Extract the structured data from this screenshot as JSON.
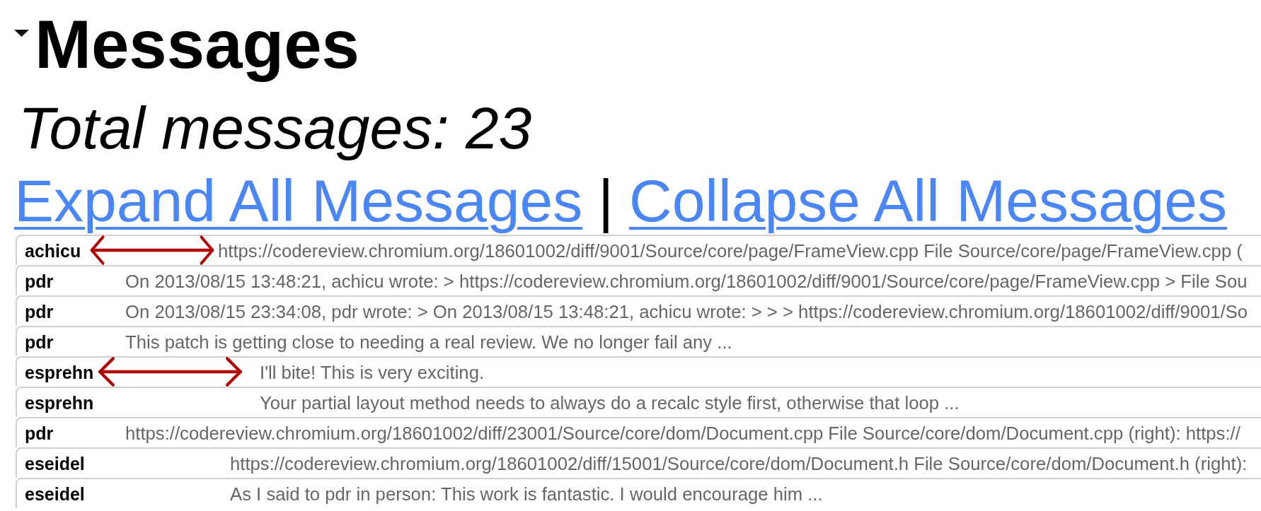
{
  "section": {
    "title": "Messages",
    "expanded": true
  },
  "total": "Total messages: 23",
  "actions": {
    "expand": "Expand All Messages",
    "separator": "|",
    "collapse": "Collapse All Messages"
  },
  "messages": [
    {
      "author": "achicu",
      "text": "https://codereview.chromium.org/18601002/diff/9001/Source/core/page/FrameView.cpp File Source/core/page/FrameView.cpp (",
      "annotated": true
    },
    {
      "author": "pdr",
      "text": "On 2013/08/15 13:48:21, achicu wrote: > https://codereview.chromium.org/18601002/diff/9001/Source/core/page/FrameView.cpp > File Sou",
      "annotated": false
    },
    {
      "author": "pdr",
      "text": "On 2013/08/15 23:34:08, pdr wrote: > On 2013/08/15 13:48:21, achicu wrote: > > > https://codereview.chromium.org/18601002/diff/9001/So",
      "annotated": false
    },
    {
      "author": "pdr",
      "text": "This patch is getting close to needing a real review. We no longer fail any ...",
      "annotated": false
    },
    {
      "author": "esprehn",
      "text": "I'll bite! This is very exciting.",
      "annotated": true
    },
    {
      "author": "esprehn",
      "text": "Your partial layout method needs to always do a recalc style first, otherwise that loop ...",
      "annotated": false
    },
    {
      "author": "pdr",
      "text": "https://codereview.chromium.org/18601002/diff/23001/Source/core/dom/Document.cpp File Source/core/dom/Document.cpp (right): https://",
      "annotated": false
    },
    {
      "author": "eseidel",
      "text": "https://codereview.chromium.org/18601002/diff/15001/Source/core/dom/Document.h File Source/core/dom/Document.h (right):",
      "annotated": false
    },
    {
      "author": "eseidel",
      "text": "As I said to pdr in person: This work is fantastic. I would encourage him ...",
      "annotated": false
    }
  ]
}
